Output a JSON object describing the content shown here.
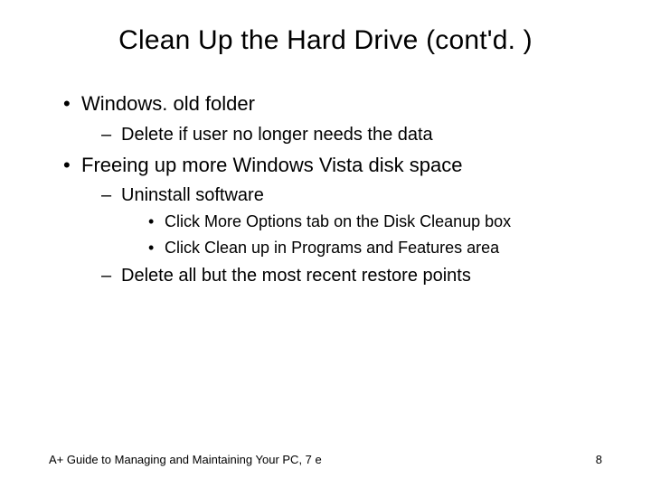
{
  "title": "Clean Up the Hard Drive (cont'd. )",
  "bullets": {
    "b1": "Windows. old folder",
    "b1_1": "Delete if user no longer needs the data",
    "b2": "Freeing up more Windows Vista disk space",
    "b2_1": "Uninstall software",
    "b2_1_1": "Click More Options tab on the Disk Cleanup box",
    "b2_1_2": "Click Clean up in Programs and Features area",
    "b2_2": "Delete all but the most recent restore points"
  },
  "footer": {
    "left": "A+ Guide to Managing and Maintaining Your PC, 7 e",
    "right": "8"
  }
}
